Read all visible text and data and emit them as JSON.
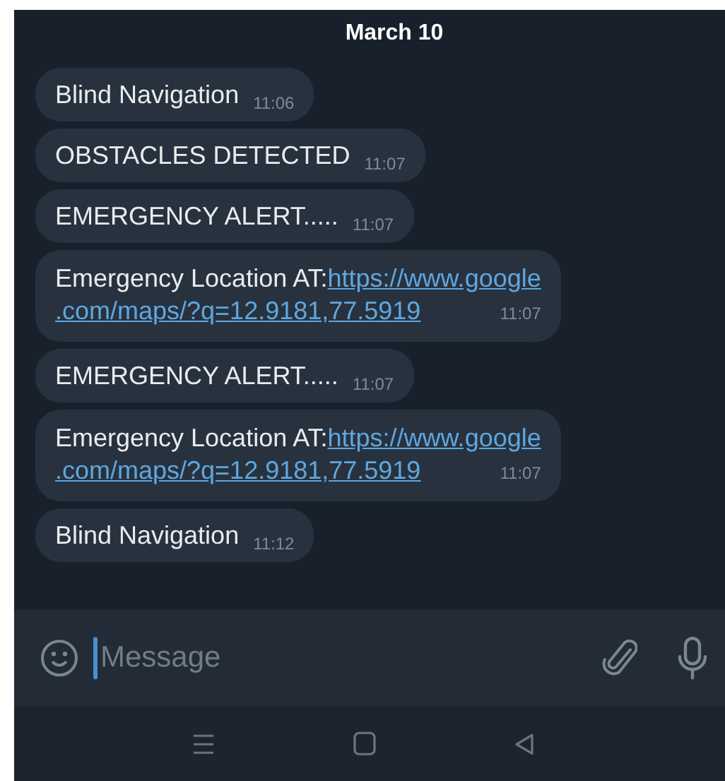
{
  "date_header": "March 10",
  "messages": [
    {
      "kind": "text",
      "text": "Blind Navigation",
      "time": "11:06"
    },
    {
      "kind": "text",
      "text": "OBSTACLES DETECTED",
      "time": "11:07"
    },
    {
      "kind": "text",
      "text": "EMERGENCY ALERT.....",
      "time": "11:07"
    },
    {
      "kind": "link",
      "text": "Emergency Location AT:",
      "link_lines": [
        "https://www.google",
        ".com/maps/?q=12.9181,77.5919"
      ],
      "time": "11:07"
    },
    {
      "kind": "text",
      "text": "EMERGENCY ALERT.....",
      "time": "11:07"
    },
    {
      "kind": "link",
      "text": "Emergency Location AT:",
      "link_lines": [
        "https://www.google",
        ".com/maps/?q=12.9181,77.5919"
      ],
      "time": "11:07"
    },
    {
      "kind": "text",
      "text": "Blind Navigation",
      "time": "11:12"
    }
  ],
  "composer": {
    "placeholder": "Message"
  }
}
